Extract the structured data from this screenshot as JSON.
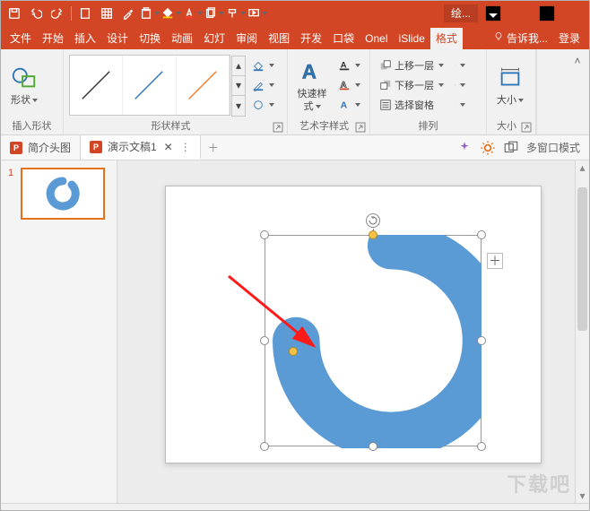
{
  "titlebar": {
    "context_label": "绘..."
  },
  "tabs": {
    "file": "文件",
    "home": "开始",
    "insert": "插入",
    "design": "设计",
    "transitions": "切换",
    "animations": "动画",
    "slideshow": "幻灯",
    "review": "审阅",
    "view": "视图",
    "developer": "开发",
    "pocket": "口袋",
    "onekey": "Onel",
    "islide": "iSlide",
    "format": "格式",
    "tellme": "告诉我...",
    "signin": "登录"
  },
  "ribbon": {
    "insert_shapes": {
      "group_label": "插入形状",
      "shapes_label": "形状"
    },
    "shape_styles": {
      "group_label": "形状样式",
      "fill_label": "",
      "outline_label": "",
      "effects_label": ""
    },
    "wordart": {
      "group_label": "艺术字样式",
      "quick_styles_label": "快速样式"
    },
    "arrange": {
      "group_label": "排列",
      "bring_forward": "上移一层",
      "send_backward": "下移一层",
      "selection_pane": "选择窗格"
    },
    "size": {
      "group_label": "大小",
      "size_label": "大小"
    }
  },
  "doctabs": {
    "doc1": "简介头图",
    "doc2": "演示文稿1",
    "multi_window": "多窗口模式"
  },
  "thumbs": {
    "slide1_number": "1"
  },
  "colors": {
    "accent": "#d24625",
    "shape_fill": "#5b9bd5"
  },
  "watermark": "下载吧"
}
